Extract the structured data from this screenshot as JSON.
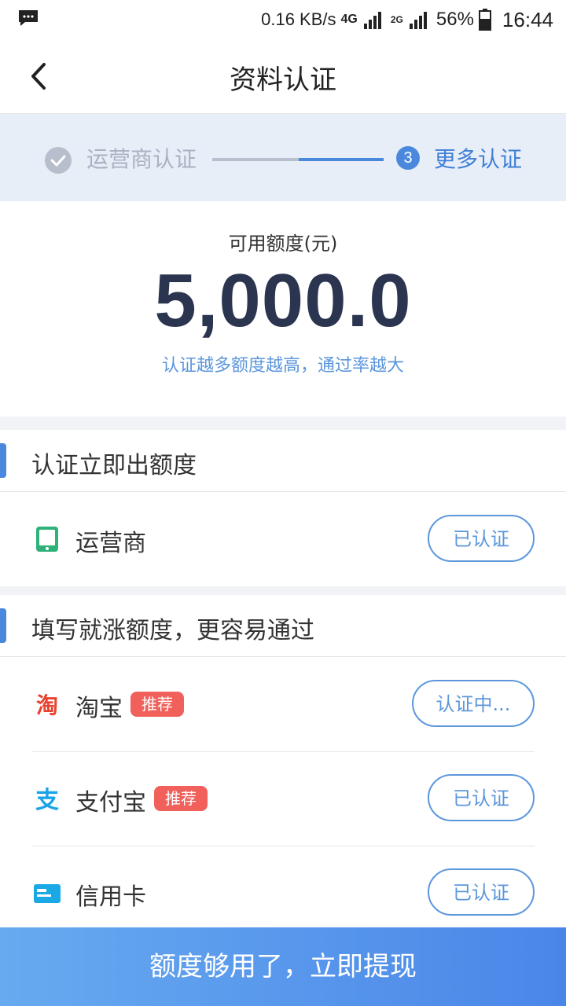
{
  "status_bar": {
    "net_speed": "0.16 KB/s",
    "network_type": "4G",
    "sim2_type": "2G",
    "battery": "56%",
    "time": "16:44"
  },
  "header": {
    "title": "资料认证"
  },
  "steps": {
    "step1_label": "运营商认证",
    "step3_number": "3",
    "step3_label": "更多认证"
  },
  "quota": {
    "label": "可用额度(元)",
    "amount": "5,000.0",
    "tip": "认证越多额度越高，通过率越大"
  },
  "section_required": {
    "title": "认证立即出额度",
    "items": [
      {
        "label": "运营商",
        "status": "已认证",
        "icon": "phone-icon"
      }
    ]
  },
  "section_optional": {
    "title": "填写就涨额度，更容易通过",
    "items": [
      {
        "label": "淘宝",
        "tag": "推荐",
        "status": "认证中...",
        "icon": "taobao-icon"
      },
      {
        "label": "支付宝",
        "tag": "推荐",
        "status": "已认证",
        "icon": "alipay-icon"
      },
      {
        "label": "信用卡",
        "status": "已认证",
        "icon": "credit-card-icon"
      }
    ]
  },
  "bottom_button": {
    "label": "额度够用了，立即提现"
  },
  "colors": {
    "accent": "#4a88dd",
    "tag_red": "#f1605b",
    "amount": "#2b3550"
  }
}
